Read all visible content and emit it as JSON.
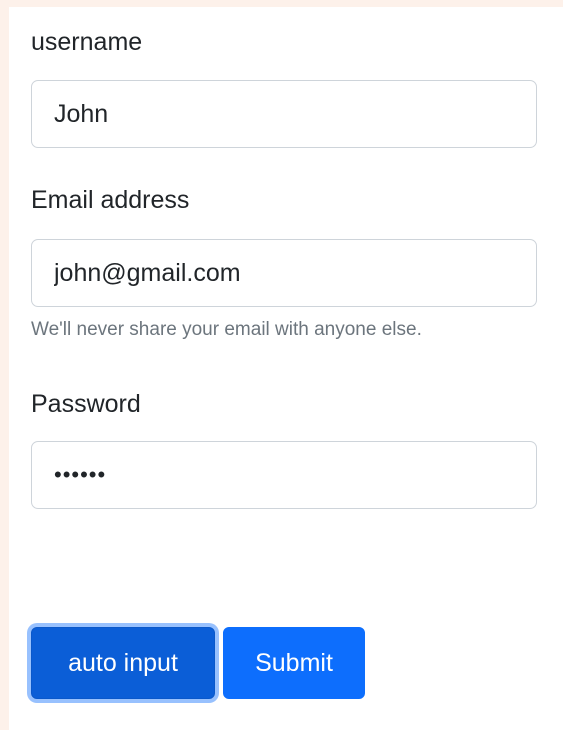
{
  "form": {
    "username": {
      "label": "username",
      "value": "John"
    },
    "email": {
      "label": "Email address",
      "value": "john@gmail.com",
      "help": "We'll never share your email with anyone else."
    },
    "password": {
      "label": "Password",
      "value": "••••••"
    }
  },
  "buttons": {
    "auto_input": "auto input",
    "submit": "Submit"
  },
  "colors": {
    "primary": "#0d6efd",
    "primary_active": "#0b5ed7",
    "page_background": "#fdf1ea"
  }
}
